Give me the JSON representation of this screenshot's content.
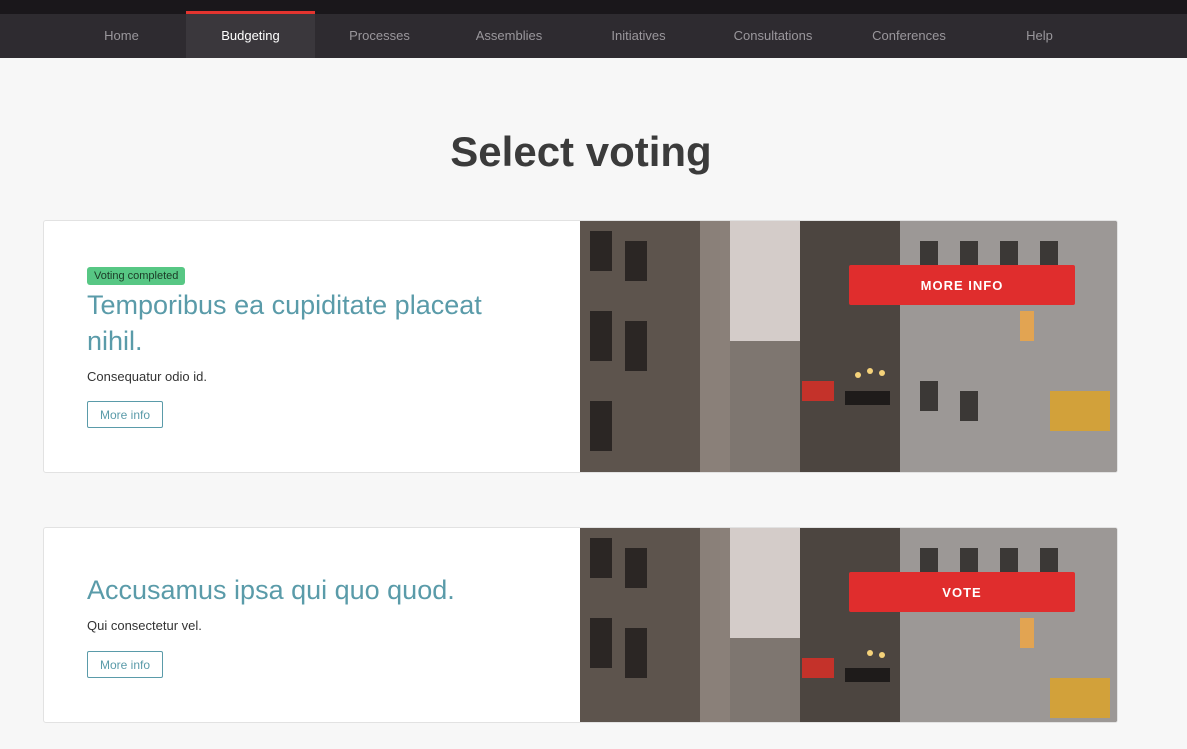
{
  "nav": {
    "items": [
      {
        "label": "Home"
      },
      {
        "label": "Budgeting",
        "active": true
      },
      {
        "label": "Processes"
      },
      {
        "label": "Assemblies"
      },
      {
        "label": "Initiatives"
      },
      {
        "label": "Consultations"
      },
      {
        "label": "Conferences"
      },
      {
        "label": "Help"
      }
    ],
    "accent_color": "#e3342f"
  },
  "page": {
    "title": "Select voting"
  },
  "votings": [
    {
      "badge": "Voting completed",
      "title": "Temporibus ea cupiditate placeat nihil.",
      "description": "Consequatur odio id.",
      "more_info_label": "More info",
      "cta_label": "MORE INFO"
    },
    {
      "title": "Accusamus ipsa qui quo quod.",
      "description": "Qui consectetur vel.",
      "more_info_label": "More info",
      "cta_label": "VOTE"
    }
  ],
  "colors": {
    "title_link": "#5a9ba9",
    "badge_bg": "#57c784",
    "cta_bg": "#e02d2d"
  }
}
